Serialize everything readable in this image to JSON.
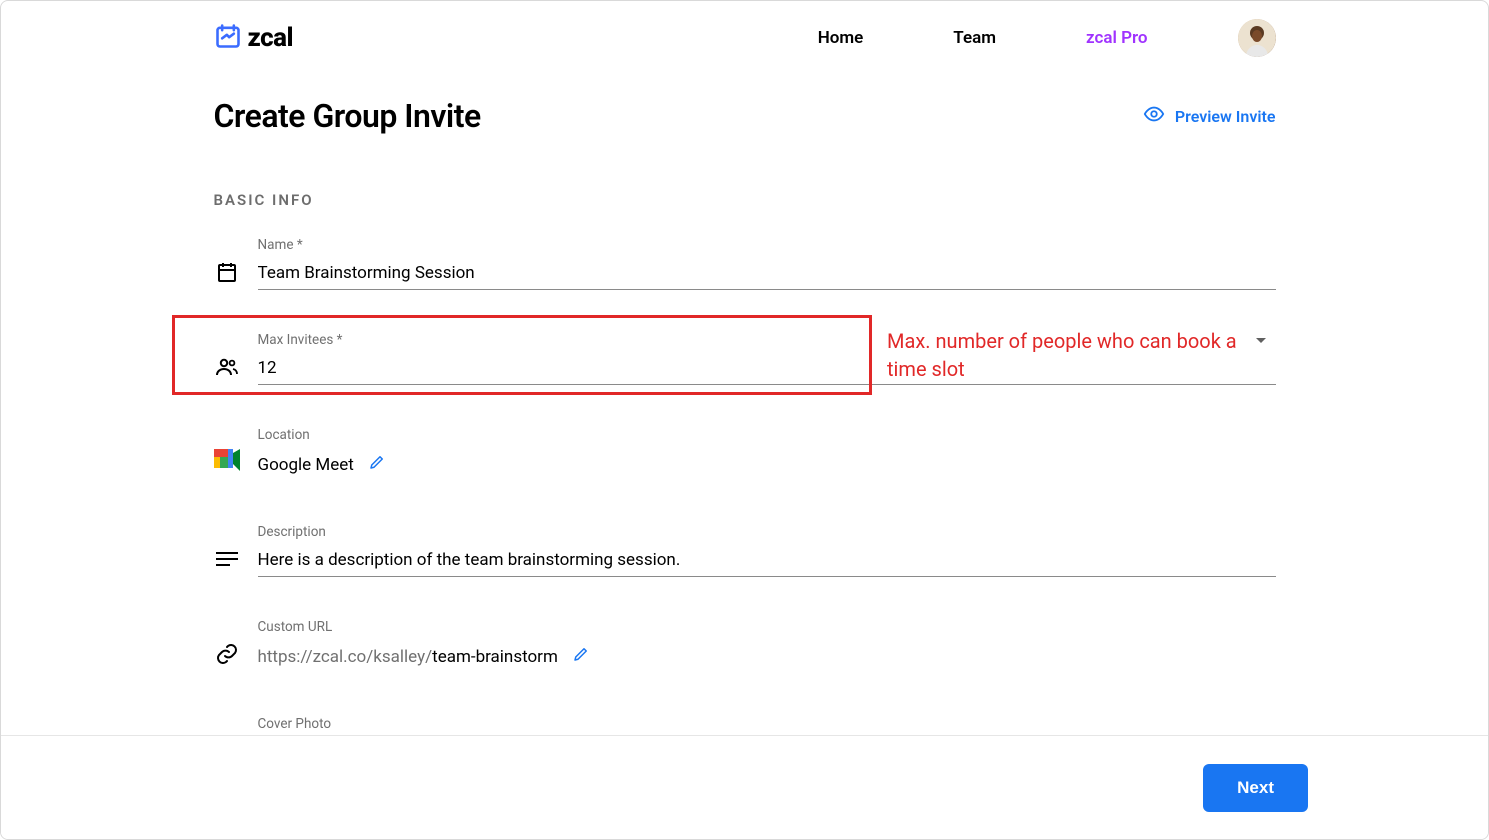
{
  "header": {
    "logo_text": "zcal",
    "nav": {
      "home": "Home",
      "team": "Team",
      "pro": "zcal Pro"
    }
  },
  "page": {
    "title": "Create Group Invite",
    "preview_label": "Preview Invite",
    "section_label": "BASIC INFO"
  },
  "form": {
    "name": {
      "label": "Name *",
      "value": "Team Brainstorming Session"
    },
    "max_invitees": {
      "label": "Max Invitees *",
      "value": "12"
    },
    "location": {
      "label": "Location",
      "value": "Google Meet"
    },
    "description": {
      "label": "Description",
      "value": "Here is a description of the team brainstorming session."
    },
    "custom_url": {
      "label": "Custom URL",
      "prefix": "https://zcal.co/ksalley/",
      "slug": "team-brainstorm"
    },
    "cover_photo": {
      "label": "Cover Photo"
    }
  },
  "annotation": {
    "text": "Max. number of people who can book a time slot"
  },
  "footer": {
    "next": "Next"
  },
  "colors": {
    "primary_blue": "#1976f2",
    "pro_purple": "#a033ff",
    "anno_red": "#e12828",
    "muted_gray": "#707070"
  }
}
